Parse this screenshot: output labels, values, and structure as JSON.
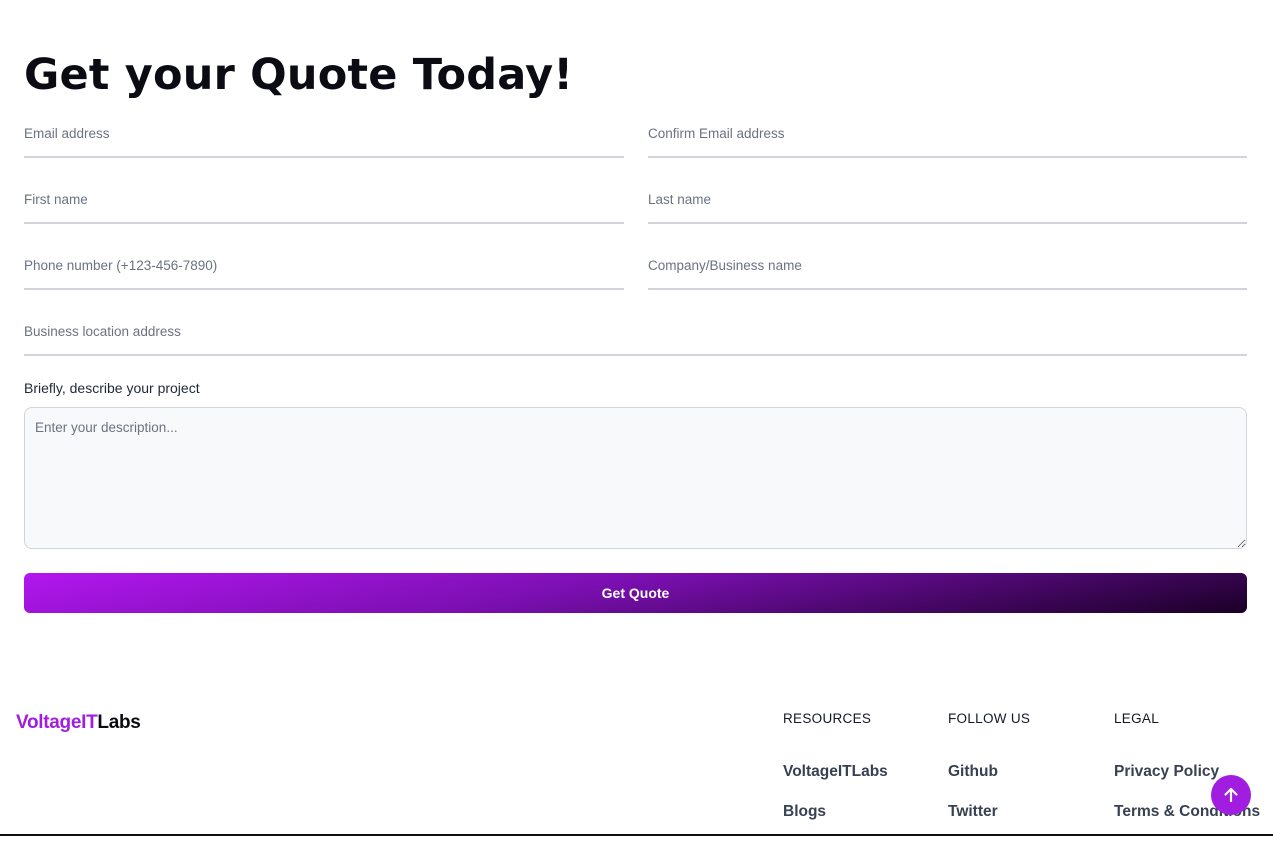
{
  "form": {
    "heading": "Get your Quote Today!",
    "fields": {
      "email": {
        "placeholder": "Email address",
        "value": ""
      },
      "confirm_email": {
        "placeholder": "Confirm Email address",
        "value": ""
      },
      "first_name": {
        "placeholder": "First name",
        "value": ""
      },
      "last_name": {
        "placeholder": "Last name",
        "value": ""
      },
      "phone": {
        "placeholder": "Phone number (+123-456-7890)",
        "value": ""
      },
      "company": {
        "placeholder": "Company/Business name",
        "value": ""
      },
      "address": {
        "placeholder": "Business location address",
        "value": ""
      }
    },
    "description_label": "Briefly, describe your project",
    "description_placeholder": "Enter your description...",
    "submit_label": "Get Quote"
  },
  "footer": {
    "logo_part1": "VoltageIT",
    "logo_part2": "Labs",
    "columns": [
      {
        "title": "RESOURCES",
        "links": [
          "VoltageITLabs",
          "Blogs"
        ]
      },
      {
        "title": "FOLLOW US",
        "links": [
          "Github",
          "Twitter"
        ]
      },
      {
        "title": "LEGAL",
        "links": [
          "Privacy Policy",
          "Terms & Conditions"
        ]
      }
    ]
  },
  "icons": {
    "scroll_top": "arrow-up-icon"
  },
  "colors": {
    "accent": "#a11de0",
    "button_gradient_start": "#b317f0",
    "button_gradient_end": "#1a0026"
  }
}
